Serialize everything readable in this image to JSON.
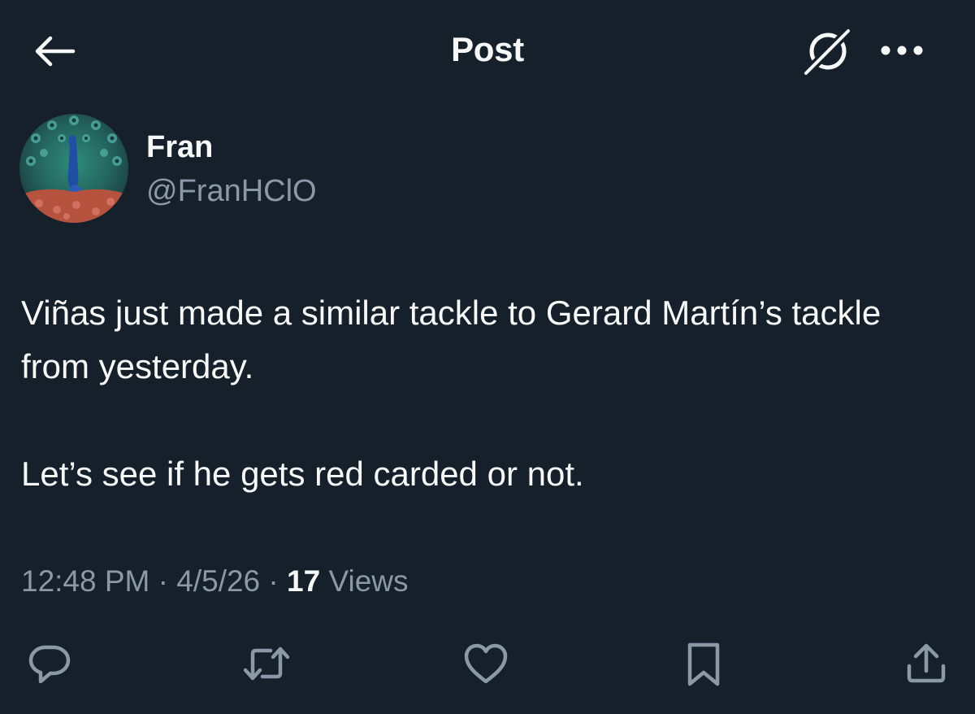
{
  "header": {
    "title": "Post",
    "back_icon": "arrow-left-icon",
    "grok_icon": "grok-icon",
    "more_icon": "more-dots-icon"
  },
  "author": {
    "display_name": "Fran",
    "handle": "@FranHClO",
    "avatar": "peacock-avatar"
  },
  "post": {
    "paragraphs": [
      "Viñas just made a similar tackle to Gerard Martín’s tackle from yesterday.",
      "Let’s see if he gets red carded or not."
    ]
  },
  "meta": {
    "time": "12:48 PM",
    "sep1": " · ",
    "date": "4/5/26",
    "sep2": " · ",
    "views_count": "17",
    "views_label": " Views"
  },
  "actions": [
    {
      "name": "reply",
      "icon": "reply-icon"
    },
    {
      "name": "repost",
      "icon": "repost-icon"
    },
    {
      "name": "like",
      "icon": "heart-icon"
    },
    {
      "name": "bookmark",
      "icon": "bookmark-icon"
    },
    {
      "name": "share",
      "icon": "share-icon"
    }
  ],
  "colors": {
    "background": "#15202b",
    "text_primary": "#f7f9f9",
    "text_secondary": "#8b98a5"
  }
}
